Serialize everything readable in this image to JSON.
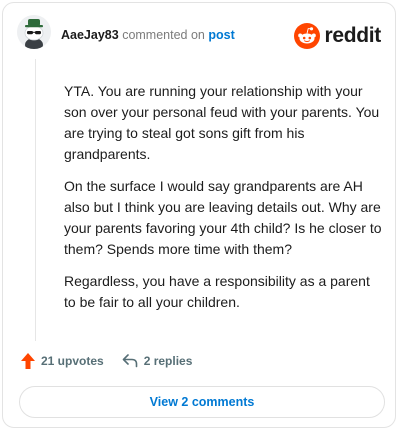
{
  "header": {
    "username": "AaeJay83",
    "commented_text": "commented on",
    "post_link": "post"
  },
  "brand": {
    "name": "reddit",
    "color": "#ff4500"
  },
  "comment": {
    "paragraphs": [
      "YTA. You are running your relationship with your son over your personal feud with your parents. You are trying to steal got sons gift from his grandparents.",
      "On the surface I would say grandparents are AH also but I think you are leaving details out. Why are your parents favoring your 4th child? Is he closer to them? Spends more time with them?",
      "Regardless, you have a responsibility as a parent to be fair to all your children."
    ]
  },
  "actions": {
    "upvotes": "21 upvotes",
    "replies": "2 replies",
    "upvote_icon": "upvote-arrow-icon",
    "reply_icon": "reply-arrow-icon"
  },
  "footer": {
    "view_comments": "View 2 comments"
  },
  "colors": {
    "accent": "#0079d3",
    "upvote": "#ff4500",
    "muted": "#576f76"
  }
}
